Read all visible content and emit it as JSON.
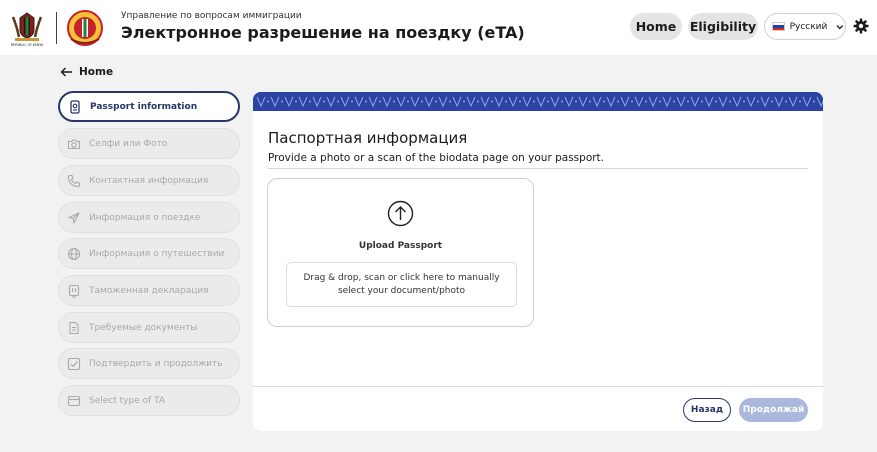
{
  "header": {
    "subtitle": "Управление по вопросам иммиграции",
    "title": "Электронное разрешение на поездку (eTA)",
    "home_label": "Home",
    "eligibility_label": "Eligibility",
    "language": "Русский",
    "coat_of_arms_text": "REPUBLIC OF KENYA"
  },
  "back": {
    "label": "Home"
  },
  "sidebar": {
    "items": [
      {
        "label": "Passport information",
        "icon": "passport-icon",
        "active": true
      },
      {
        "label": "Селфи или Фото",
        "icon": "camera-icon"
      },
      {
        "label": "Контактная информация",
        "icon": "phone-icon"
      },
      {
        "label": "Информация о поездке",
        "icon": "airplane-icon"
      },
      {
        "label": "Информация о путешествии",
        "icon": "globe-icon"
      },
      {
        "label": "Таможенная декларация",
        "icon": "customs-icon"
      },
      {
        "label": "Требуемые документы",
        "icon": "documents-icon"
      },
      {
        "label": "Подтвердить и продолжить",
        "icon": "checkbox-icon"
      },
      {
        "label": "Select type of TA",
        "icon": "card-icon"
      }
    ]
  },
  "main": {
    "title": "Паспортная информация",
    "description": "Provide a photo or a scan of the biodata page on your passport.",
    "upload_label": "Upload Passport",
    "drop_text": "Drag & drop, scan or click here to manually select your document/photo",
    "back_button": "Назад",
    "next_button": "Продолжай"
  },
  "colors": {
    "accent": "#27376b",
    "banner": "#2b44a4",
    "disabled_button": "#a9b8dc",
    "page_background": "#f2f2f2"
  }
}
